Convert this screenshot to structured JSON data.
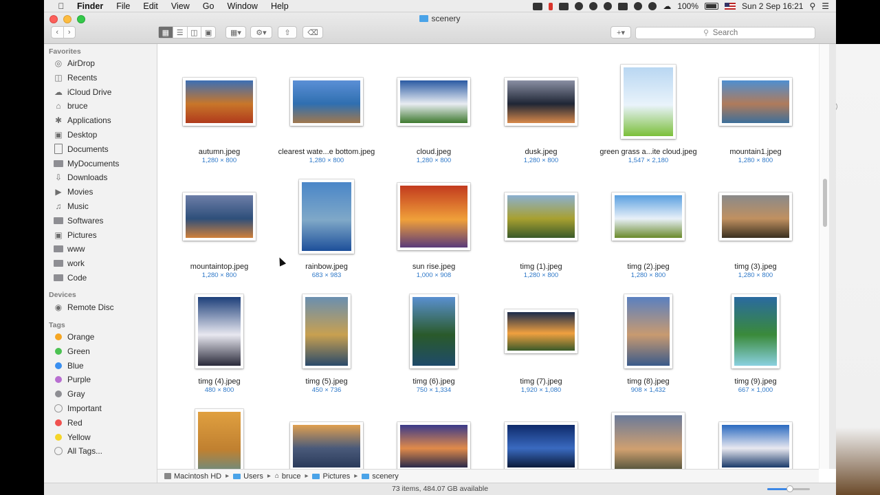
{
  "menubar": {
    "app_name": "Finder",
    "items": [
      "File",
      "Edit",
      "View",
      "Go",
      "Window",
      "Help"
    ],
    "battery": "100%",
    "datetime": "Sun 2 Sep  16:21"
  },
  "window": {
    "title": "scenery",
    "search_placeholder": "Search"
  },
  "sidebar": {
    "favorites_header": "Favorites",
    "favorites": [
      {
        "label": "AirDrop",
        "icon": "airdrop-icon"
      },
      {
        "label": "Recents",
        "icon": "recents-icon"
      },
      {
        "label": "iCloud Drive",
        "icon": "cloud-icon"
      },
      {
        "label": "bruce",
        "icon": "home-icon"
      },
      {
        "label": "Applications",
        "icon": "applications-icon"
      },
      {
        "label": "Desktop",
        "icon": "desktop-icon"
      },
      {
        "label": "Documents",
        "icon": "documents-icon"
      },
      {
        "label": "MyDocuments",
        "icon": "folder-icon"
      },
      {
        "label": "Downloads",
        "icon": "downloads-icon"
      },
      {
        "label": "Movies",
        "icon": "movies-icon"
      },
      {
        "label": "Music",
        "icon": "music-icon"
      },
      {
        "label": "Softwares",
        "icon": "folder-icon"
      },
      {
        "label": "Pictures",
        "icon": "pictures-icon"
      },
      {
        "label": "www",
        "icon": "folder-icon"
      },
      {
        "label": "work",
        "icon": "folder-icon"
      },
      {
        "label": "Code",
        "icon": "folder-icon"
      }
    ],
    "devices_header": "Devices",
    "devices": [
      {
        "label": "Remote Disc",
        "icon": "disc-icon"
      }
    ],
    "tags_header": "Tags",
    "tags": [
      {
        "label": "Orange",
        "color": "#f5a623"
      },
      {
        "label": "Green",
        "color": "#4cc252"
      },
      {
        "label": "Blue",
        "color": "#3a8ff0"
      },
      {
        "label": "Purple",
        "color": "#b86fd1"
      },
      {
        "label": "Gray",
        "color": "#8e8e93"
      },
      {
        "label": "Important",
        "color": ""
      },
      {
        "label": "Red",
        "color": "#f0524f"
      },
      {
        "label": "Yellow",
        "color": "#f5d52a"
      },
      {
        "label": "All Tags...",
        "color": ""
      }
    ]
  },
  "files": [
    {
      "name": "autumn.jpeg",
      "dims": "1,280 × 800",
      "orientation": "landscape"
    },
    {
      "name": "clearest wate...e bottom.jpeg",
      "dims": "1,280 × 800",
      "orientation": "landscape"
    },
    {
      "name": "cloud.jpeg",
      "dims": "1,280 × 800",
      "orientation": "landscape"
    },
    {
      "name": "dusk.jpeg",
      "dims": "1,280 × 800",
      "orientation": "landscape"
    },
    {
      "name": "green grass a...ite cloud.jpeg",
      "dims": "1,547 × 2,180",
      "orientation": "portrait"
    },
    {
      "name": "mountain1.jpeg",
      "dims": "1,280 × 800",
      "orientation": "landscape"
    },
    {
      "name": "mountaintop.jpeg",
      "dims": "1,280 × 800",
      "orientation": "landscape"
    },
    {
      "name": "rainbow.jpeg",
      "dims": "683 × 983",
      "orientation": "portrait"
    },
    {
      "name": "sun rise.jpeg",
      "dims": "1,000 × 908",
      "orientation": "square"
    },
    {
      "name": "timg (1).jpeg",
      "dims": "1,280 × 800",
      "orientation": "landscape"
    },
    {
      "name": "timg (2).jpeg",
      "dims": "1,280 × 800",
      "orientation": "landscape"
    },
    {
      "name": "timg (3).jpeg",
      "dims": "1,280 × 800",
      "orientation": "landscape"
    },
    {
      "name": "timg (4).jpeg",
      "dims": "480 × 800",
      "orientation": "tall"
    },
    {
      "name": "timg (5).jpeg",
      "dims": "450 × 736",
      "orientation": "tall"
    },
    {
      "name": "timg (6).jpeg",
      "dims": "750 × 1,334",
      "orientation": "tall"
    },
    {
      "name": "timg (7).jpeg",
      "dims": "1,920 × 1,080",
      "orientation": "wide"
    },
    {
      "name": "timg (8).jpeg",
      "dims": "908 × 1,432",
      "orientation": "tall"
    },
    {
      "name": "timg (9).jpeg",
      "dims": "667 × 1,000",
      "orientation": "tall"
    },
    {
      "name": "",
      "dims": "",
      "orientation": "tall"
    },
    {
      "name": "",
      "dims": "",
      "orientation": "landscape"
    },
    {
      "name": "",
      "dims": "",
      "orientation": "landscape"
    },
    {
      "name": "",
      "dims": "",
      "orientation": "landscape"
    },
    {
      "name": "",
      "dims": "",
      "orientation": "square"
    },
    {
      "name": "",
      "dims": "",
      "orientation": "landscape"
    }
  ],
  "thumb_colors": [
    [
      "#3c6fb5",
      "#c8762a",
      "#b03a1c"
    ],
    [
      "#5b8fd6",
      "#2f6fb0",
      "#a0784e"
    ],
    [
      "#2a5aa3",
      "#e8ecf2",
      "#3f7a2f"
    ],
    [
      "#8a8fa3",
      "#1f2635",
      "#d8894a"
    ],
    [
      "#b9d7f2",
      "#e9f3fb",
      "#7bbf3a"
    ],
    [
      "#4f8fd0",
      "#b07b5b",
      "#3d6f9a"
    ],
    [
      "#6d7ea8",
      "#2e4f7a",
      "#d0803a"
    ],
    [
      "#4a86c8",
      "#7fa8c8",
      "#1d4f9a"
    ],
    [
      "#c23a1e",
      "#f0a03a",
      "#5a3a7a"
    ],
    [
      "#8bb0d0",
      "#a8a030",
      "#3a5a2a"
    ],
    [
      "#5aa0e0",
      "#e8f0f8",
      "#6a8a2a"
    ],
    [
      "#8a8a8a",
      "#c09060",
      "#3a3020"
    ],
    [
      "#1d3f7a",
      "#e8e8f0",
      "#2a2a3a"
    ],
    [
      "#6a8fb0",
      "#c8a050",
      "#2a4a6a"
    ],
    [
      "#5a90d0",
      "#2a5a2a",
      "#1e4a6a"
    ],
    [
      "#1a2a4a",
      "#f0a040",
      "#3a5a2a"
    ],
    [
      "#5a80c0",
      "#c89a70",
      "#3a5a8a"
    ],
    [
      "#2a6aa0",
      "#3a8a3a",
      "#8ad0e0"
    ],
    [
      "#e0a040",
      "#c08030",
      "#4a90a0"
    ],
    [
      "#e0a050",
      "#4a5a7a",
      "#2a3a5a"
    ],
    [
      "#3a3a8a",
      "#e08a4a",
      "#2a2a4a"
    ],
    [
      "#0e2a6a",
      "#3a6ac0",
      "#0a1a3a"
    ],
    [
      "#6a7a9a",
      "#d0a070",
      "#2a3a2a"
    ],
    [
      "#2a6ac0",
      "#e8e8f0",
      "#1a3a6a"
    ]
  ],
  "pathbar": [
    "Macintosh HD",
    "Users",
    "bruce",
    "Pictures",
    "scenery"
  ],
  "status": "73 items, 484.07 GB available"
}
